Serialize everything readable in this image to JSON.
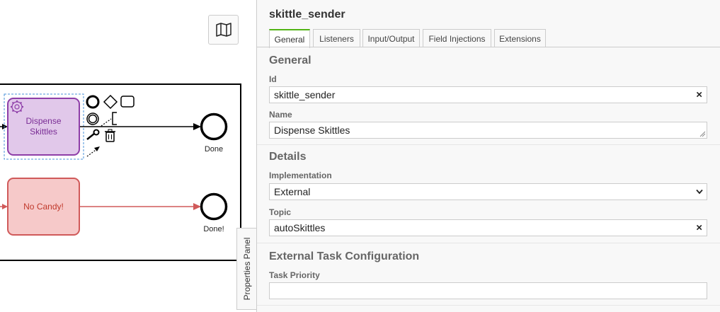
{
  "diagram": {
    "task_dispense": "Dispense Skittles",
    "task_dispense_lines": [
      "Dispense",
      "Skittles"
    ],
    "task_nocandy": "No Candy!",
    "end_done": "Done",
    "end_done2": "Done!"
  },
  "panel_toggle_label": "Properties Panel",
  "panel": {
    "title": "skittle_sender",
    "tabs": [
      {
        "label": "General",
        "active": true
      },
      {
        "label": "Listeners"
      },
      {
        "label": "Input/Output"
      },
      {
        "label": "Field Injections"
      },
      {
        "label": "Extensions"
      }
    ],
    "general": {
      "heading": "General",
      "id_label": "Id",
      "id_value": "skittle_sender",
      "name_label": "Name",
      "name_value": "Dispense Skittles"
    },
    "details": {
      "heading": "Details",
      "implementation_label": "Implementation",
      "implementation_value": "External",
      "topic_label": "Topic",
      "topic_value": "autoSkittles"
    },
    "external": {
      "heading": "External Task Configuration",
      "priority_label": "Task Priority",
      "priority_value": ""
    },
    "clear_symbol": "×"
  },
  "colors": {
    "task_purple_fill": "#e1c8ea",
    "task_purple_stroke": "#8e3ea8",
    "task_red_fill": "#f6c9c9",
    "task_red_stroke": "#d05a5a",
    "active_tab_accent": "#52b415"
  }
}
